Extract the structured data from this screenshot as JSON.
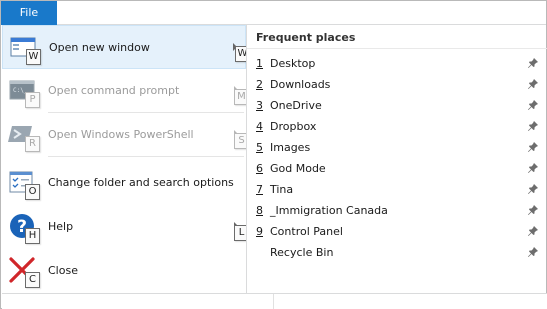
{
  "ribbon": {
    "file_tab": "File"
  },
  "file_menu": {
    "items": [
      {
        "label": "Open new window",
        "keytip": "W",
        "sub_keytip": "W",
        "enabled": true,
        "icon": "new-window-icon"
      },
      {
        "label": "Open command prompt",
        "keytip": "P",
        "sub_keytip": "M",
        "enabled": false,
        "icon": "command-prompt-icon"
      },
      {
        "label": "Open Windows PowerShell",
        "keytip": "R",
        "sub_keytip": "S",
        "enabled": false,
        "icon": "powershell-icon"
      },
      {
        "label": "Change folder and search options",
        "keytip": "O",
        "enabled": true,
        "icon": "folder-options-icon"
      },
      {
        "label": "Help",
        "keytip": "H",
        "sub_keytip": "L",
        "enabled": true,
        "icon": "help-icon"
      },
      {
        "label": "Close",
        "keytip": "C",
        "enabled": true,
        "icon": "close-icon"
      }
    ]
  },
  "frequent_places": {
    "title": "Frequent places",
    "items": [
      {
        "num": "1",
        "name": "Desktop"
      },
      {
        "num": "2",
        "name": "Downloads"
      },
      {
        "num": "3",
        "name": "OneDrive"
      },
      {
        "num": "4",
        "name": "Dropbox"
      },
      {
        "num": "5",
        "name": "Images"
      },
      {
        "num": "6",
        "name": "God Mode"
      },
      {
        "num": "7",
        "name": "Tina"
      },
      {
        "num": "8",
        "name": "_Immigration Canada"
      },
      {
        "num": "9",
        "name": "Control Panel"
      },
      {
        "num": "",
        "name": "Recycle Bin"
      }
    ]
  }
}
